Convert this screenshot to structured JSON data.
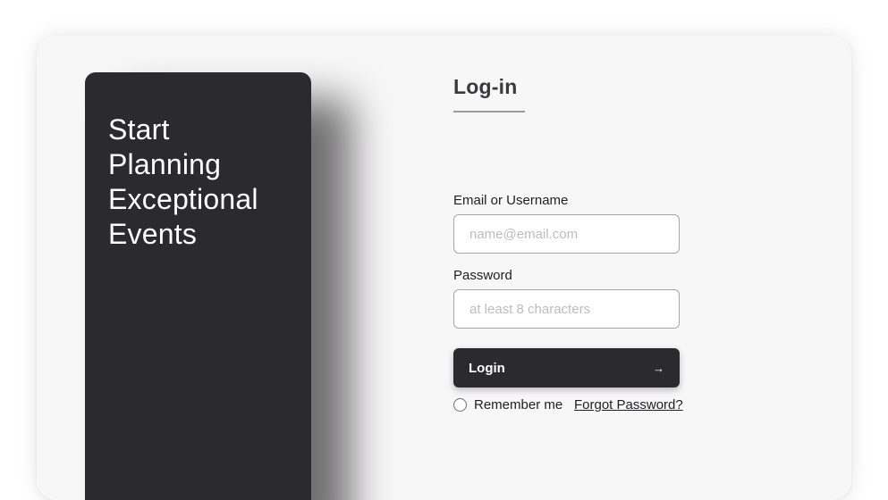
{
  "hero": {
    "title_lines": [
      "Start",
      "Planning",
      "Exceptional",
      "Events"
    ]
  },
  "login": {
    "title": "Log-in",
    "email_label": "Email or Username",
    "email_placeholder": "name@email.com",
    "email_value": "",
    "password_label": "Password",
    "password_placeholder": "at least 8 characters",
    "password_value": "",
    "button_label": "Login",
    "button_icon": "→",
    "remember_label": "Remember me",
    "remember_checked": false,
    "forgot_label": "Forgot Password?"
  },
  "colors": {
    "card_bg": "#f8f7f8",
    "dark": "#2b2a2d",
    "text": "#1f1e21",
    "placeholder": "#bdbcbf"
  }
}
